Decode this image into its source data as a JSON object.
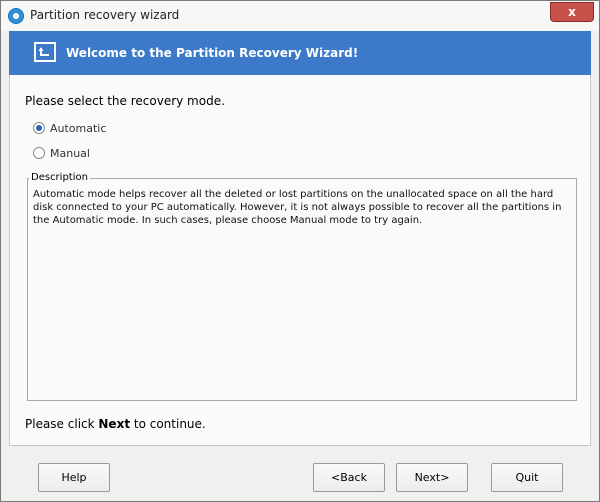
{
  "window": {
    "title": "Partition recovery wizard",
    "close_label": "x"
  },
  "banner": {
    "title": "Welcome to the Partition Recovery Wizard!"
  },
  "content": {
    "prompt": "Please select the recovery mode.",
    "modes": [
      {
        "label": "Automatic",
        "checked": true
      },
      {
        "label": "Manual",
        "checked": false
      }
    ],
    "description_legend": "Description",
    "description_text": "Automatic mode helps recover all the deleted or lost partitions on the unallocated space on all the hard disk connected to your PC automatically. However, it is not always possible to recover all the partitions in the Automatic mode. In such cases, please choose Manual mode to try again.",
    "continue_prefix": "Please click ",
    "continue_bold": "Next",
    "continue_suffix": " to continue."
  },
  "buttons": {
    "help": "Help",
    "back": "<Back",
    "next": "Next>",
    "quit": "Quit"
  },
  "colors": {
    "banner": "#3c79c9",
    "close": "#c7504a"
  }
}
